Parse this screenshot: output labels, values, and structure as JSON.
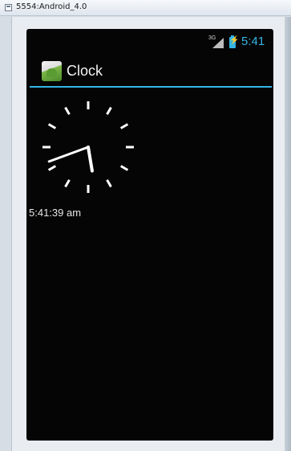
{
  "window": {
    "title": "5554:Android_4.0"
  },
  "status_bar": {
    "network": "3G",
    "time": "5:41",
    "accent": "#33b5e5"
  },
  "action_bar": {
    "title": "Clock"
  },
  "clock": {
    "hour": 5,
    "minute": 41,
    "second": 39
  },
  "time_readout": "5:41:39 am"
}
